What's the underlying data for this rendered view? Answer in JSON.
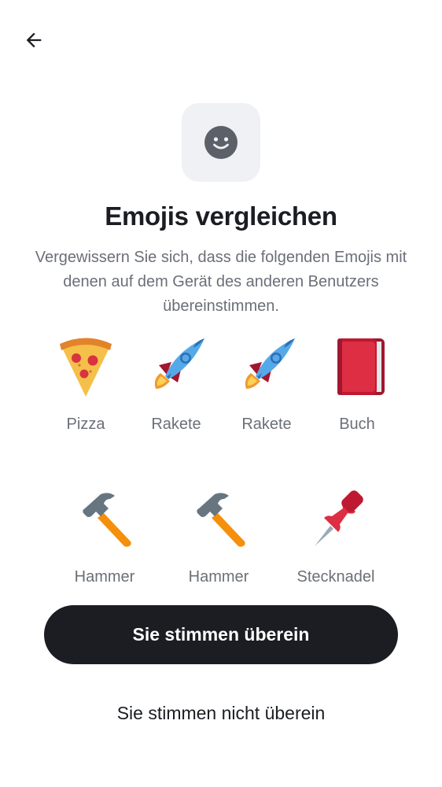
{
  "nav": {
    "back_icon": "arrow-left-icon"
  },
  "header": {
    "icon": "smiley-icon"
  },
  "title": "Emojis vergleichen",
  "description": "Vergewissern Sie sich, dass die folgenden Emojis mit denen auf dem Gerät des anderen Benutzers übereinstimmen.",
  "emojis": [
    {
      "label": "Pizza",
      "icon": "pizza-icon"
    },
    {
      "label": "Rakete",
      "icon": "rocket-icon"
    },
    {
      "label": "Rakete",
      "icon": "rocket-icon"
    },
    {
      "label": "Buch",
      "icon": "book-icon"
    },
    {
      "label": "Hammer",
      "icon": "hammer-icon"
    },
    {
      "label": "Hammer",
      "icon": "hammer-icon"
    },
    {
      "label": "Stecknadel",
      "icon": "pushpin-icon"
    }
  ],
  "actions": {
    "confirm_label": "Sie stimmen überein",
    "deny_label": "Sie stimmen nicht überein"
  },
  "colors": {
    "primary_button": "#1b1d22",
    "text_primary": "#1b1d22",
    "text_secondary": "#6b6f78",
    "icon_box": "#f0f1f4"
  }
}
